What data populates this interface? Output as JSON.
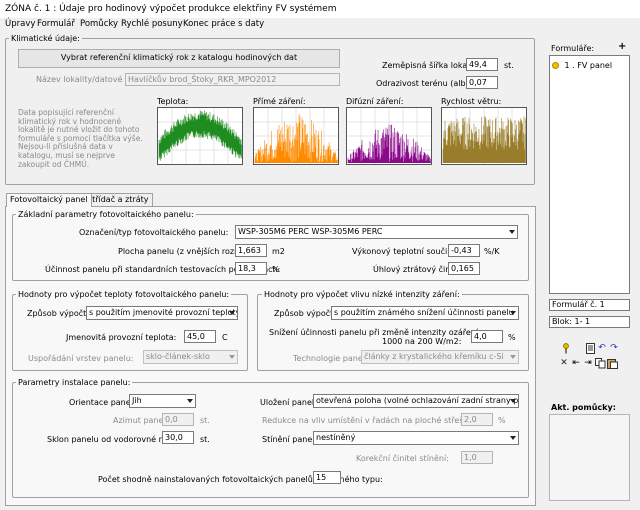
{
  "window": {
    "title": "ZÓNA č. 1 : Údaje pro hodinový výpočet produkce elektřiny FV systémem"
  },
  "menu": [
    "Úpravy",
    "Formulář",
    "Pomůcky",
    "Rychlé posuny",
    "Konec práce s daty"
  ],
  "climate": {
    "title": "Klimatické údaje:",
    "select_button": "Vybrat referenční klimatický rok z katalogu hodinových dat",
    "location_label": "Název lokality/datové sady:",
    "location_value": "Havlíčkův brod_Štoky_RKR_MPO2012",
    "latitude_label": "Zeměpisná šířka lokality:",
    "latitude_value": "49,4",
    "latitude_unit": "st.",
    "albedo_label": "Odrazivost terénu (albedo):",
    "albedo_value": "0,07",
    "info_text": "Data popisující referenční klimatický rok v hodnocené lokalitě je nutné vložit do tohoto formuláře s pomocí tlačítka výše. Nejsou-li příslušná data v katalogu, musí se nejprve zakoupit od ČHMÚ.",
    "charts": [
      {
        "label": "Teplota:",
        "color": "#1e8c1e"
      },
      {
        "label": "Přímé záření:",
        "color": "#ff8a00"
      },
      {
        "label": "Difúzní záření:",
        "color": "#8b0a8b"
      },
      {
        "label": "Rychlost větru:",
        "color": "#9a7d2a"
      }
    ]
  },
  "tabs": [
    "Fotovoltaický panel",
    "Střídač a ztráty"
  ],
  "panel_params": {
    "title": "Základní parametry fotovoltaického panelu:",
    "type_label": "Označení/typ fotovoltaického panelu:",
    "type_value": "WSP-305M6 PERC WSP-305M6 PERC",
    "area_label": "Plocha panelu (z vnějších rozměrů):",
    "area_value": "1,663",
    "area_unit": "m2",
    "coef_label": "Výkonový teplotní součinitel:",
    "coef_value": "-0,43",
    "coef_unit": "%/K",
    "eff_label": "Účinnost panelu při standardních testovacích podmínkách:",
    "eff_value": "18,3",
    "eff_unit": "%",
    "angle_loss_label": "Úhlový ztrátový činitel:",
    "angle_loss_value": "0,165"
  },
  "temp_calc": {
    "title": "Hodnoty pro výpočet teploty fotovoltaického panelu:",
    "method_label": "Způsob výpočtu:",
    "method_value": "s použitím jmenovité provozní teploty",
    "nominal_label": "Jmenovitá provozní teplota:",
    "nominal_value": "45,0",
    "nominal_unit": "C",
    "layers_label": "Uspořádání vrstev panelu:",
    "layers_value": "sklo-článek-sklo"
  },
  "low_irr": {
    "title": "Hodnoty pro výpočet vlivu nízké intenzity záření:",
    "method_label": "Způsob výpočtu:",
    "method_value": "s použitím známého snížení účinnosti panelu",
    "reduction_label_1": "Snížení účinnosti panelu při změně intenzity ozáření z",
    "reduction_label_2": "1000 na 200 W/m2:",
    "reduction_value": "4,0",
    "reduction_unit": "%",
    "tech_label": "Technologie panelu:",
    "tech_value": "články z krystalického křemíku c-Si"
  },
  "install": {
    "title": "Parametry instalace panelu:",
    "orientation_label": "Orientace panelu:",
    "orientation_value": "Jih",
    "azimuth_label": "Azimut panelu:",
    "azimuth_value": "0,0",
    "azimuth_unit": "st.",
    "tilt_label": "Sklon panelu od vodorovné roviny:",
    "tilt_value": "30,0",
    "tilt_unit": "st.",
    "placement_label": "Uložení panelu:",
    "placement_value": "otevřená poloha (volné ochlazování zadní strany panelu)",
    "row_red_label": "Redukce na vliv umístění v řadách na ploché střeše:",
    "row_red_value": "2,0",
    "row_red_unit": "%",
    "shading_label": "Stínění panelu:",
    "shading_value": "nestíněný",
    "corr_label": "Korekční činitel stínění:",
    "corr_value": "1,0",
    "count_label": "Počet shodně nainstalovaných fotovoltaických panelů popsaného typu:",
    "count_value": "15"
  },
  "side": {
    "forms_title": "Formuláře:",
    "add_symbol": "+",
    "forms": [
      "1 . FV panel"
    ],
    "form_no": "Formulář č. 1",
    "block": "Blok: 1- 1",
    "aids_title": "Akt. pomůcky:"
  }
}
